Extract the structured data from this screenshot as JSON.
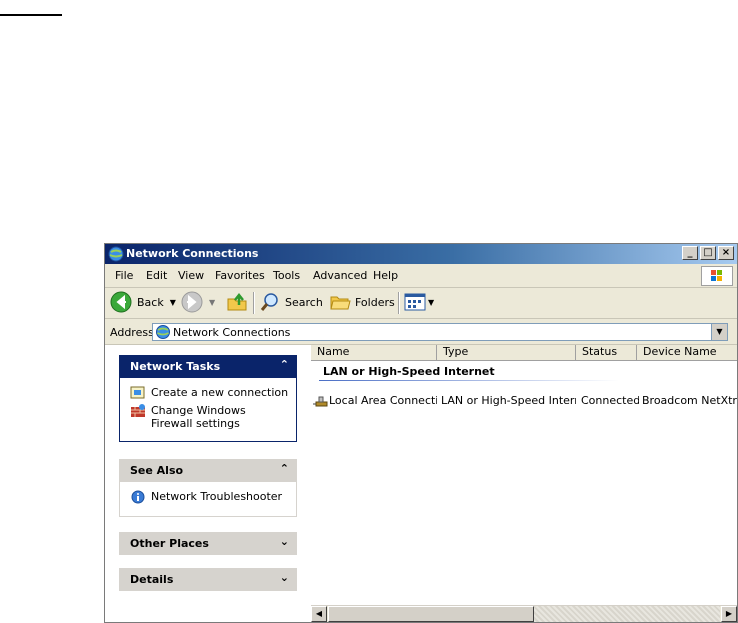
{
  "window": {
    "title": "Network Connections",
    "controls": [
      "_",
      "□",
      "×"
    ]
  },
  "menu": [
    "File",
    "Edit",
    "View",
    "Favorites",
    "Tools",
    "Advanced",
    "Help"
  ],
  "toolbar": {
    "back_label": "Back",
    "search_label": "Search",
    "folders_label": "Folders"
  },
  "address": {
    "label": "Address",
    "value": "Network Connections"
  },
  "sidebar": {
    "network_tasks": {
      "title": "Network Tasks",
      "chevron": "⌃",
      "items": [
        "Create a new connection",
        "Change Windows Firewall settings"
      ]
    },
    "see_also": {
      "title": "See Also",
      "chevron": "⌃",
      "items": [
        "Network Troubleshooter"
      ]
    },
    "other_places": {
      "title": "Other Places",
      "chevron": "⌄"
    },
    "details": {
      "title": "Details",
      "chevron": "⌄"
    }
  },
  "list": {
    "columns": [
      "Name",
      "Type",
      "Status",
      "Device Name"
    ],
    "group": "LAN or High-Speed Internet",
    "rows": [
      {
        "name": "Local Area Connection",
        "type": "LAN or High-Speed Internet",
        "status": "Connected",
        "device": "Broadcom NetXtreme"
      }
    ]
  },
  "colors": {
    "titlebar": "#0a246a",
    "panel_header": "#d6d3ce",
    "window_bg": "#ece9d8"
  }
}
